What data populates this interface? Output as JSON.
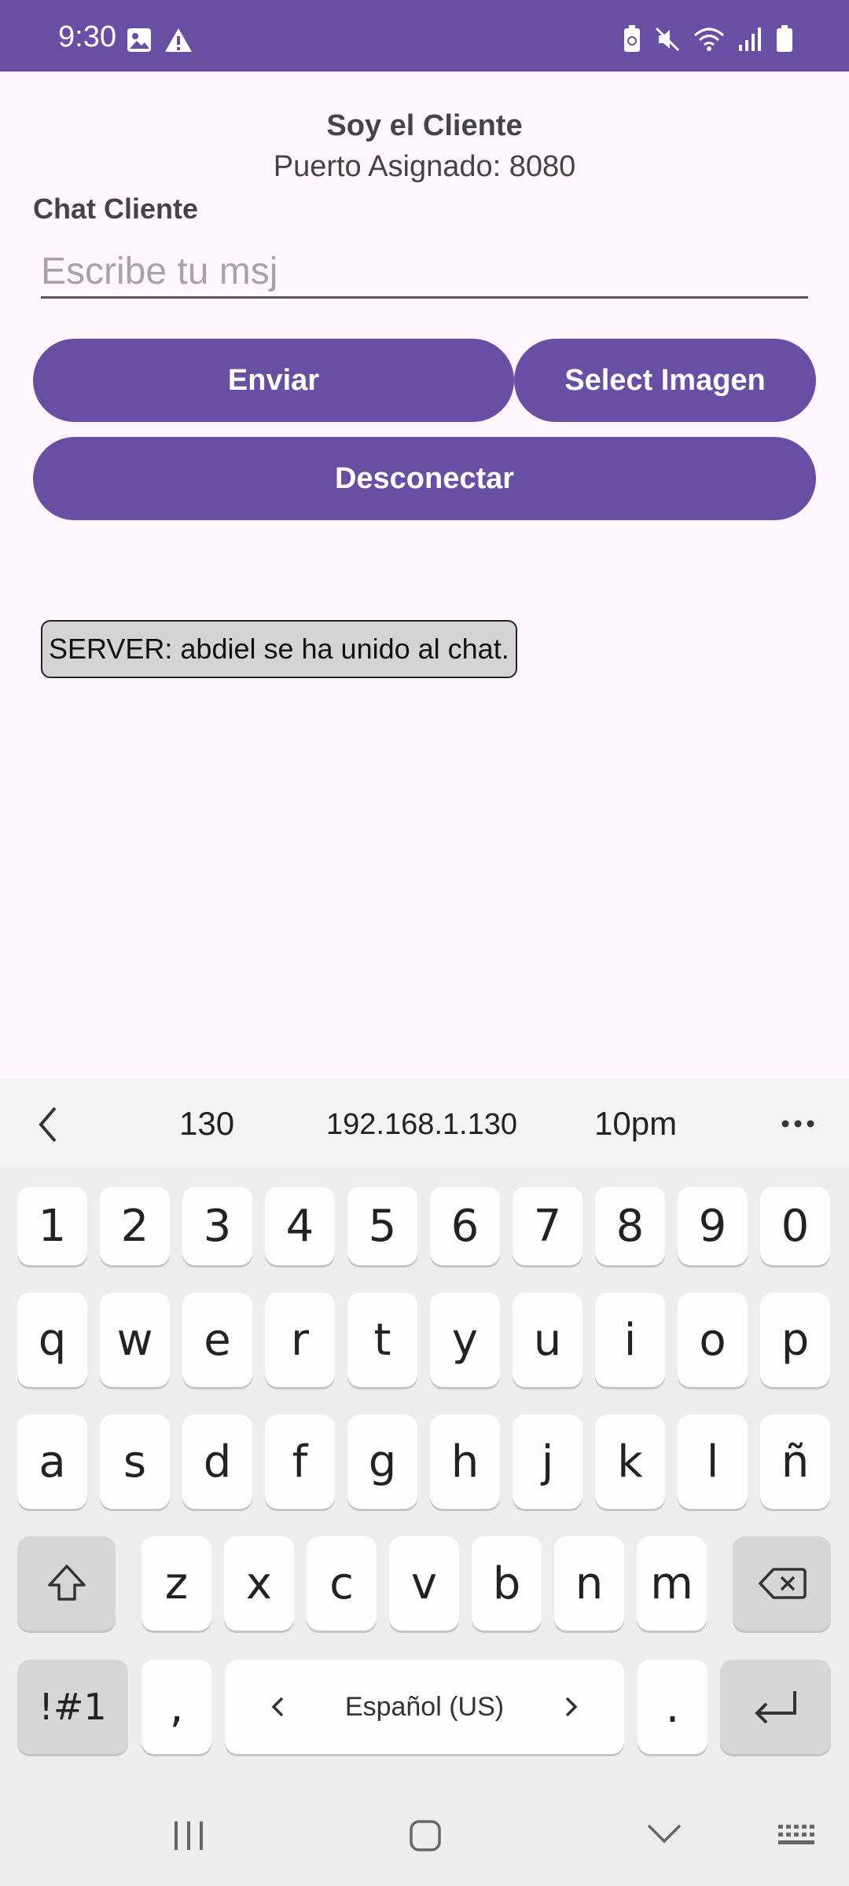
{
  "status_bar": {
    "time": "9:30"
  },
  "header": {
    "title": "Soy el Cliente",
    "port_text": "Puerto Asignado: 8080"
  },
  "chat": {
    "label": "Chat Cliente",
    "input_placeholder": "Escribe tu msj",
    "input_value": "",
    "send_label": "Enviar",
    "image_label": "Select Imagen",
    "disconnect_label": "Desconectar",
    "messages": [
      "SERVER: abdiel se ha unido al chat."
    ]
  },
  "keyboard": {
    "suggestions": [
      "130",
      "192.168.1.130",
      "10pm"
    ],
    "row_numbers": [
      "1",
      "2",
      "3",
      "4",
      "5",
      "6",
      "7",
      "8",
      "9",
      "0"
    ],
    "row_1": [
      "q",
      "w",
      "e",
      "r",
      "t",
      "y",
      "u",
      "i",
      "o",
      "p"
    ],
    "row_2": [
      "a",
      "s",
      "d",
      "f",
      "g",
      "h",
      "j",
      "k",
      "l",
      "ñ"
    ],
    "row_3": [
      "z",
      "x",
      "c",
      "v",
      "b",
      "n",
      "m"
    ],
    "symbols_label": "!#1",
    "comma": ",",
    "period": ".",
    "language": "Español (US)"
  },
  "colors": {
    "accent": "#6750A4",
    "background": "#FFF7FD",
    "keyboard_bg": "#EDEDED"
  }
}
